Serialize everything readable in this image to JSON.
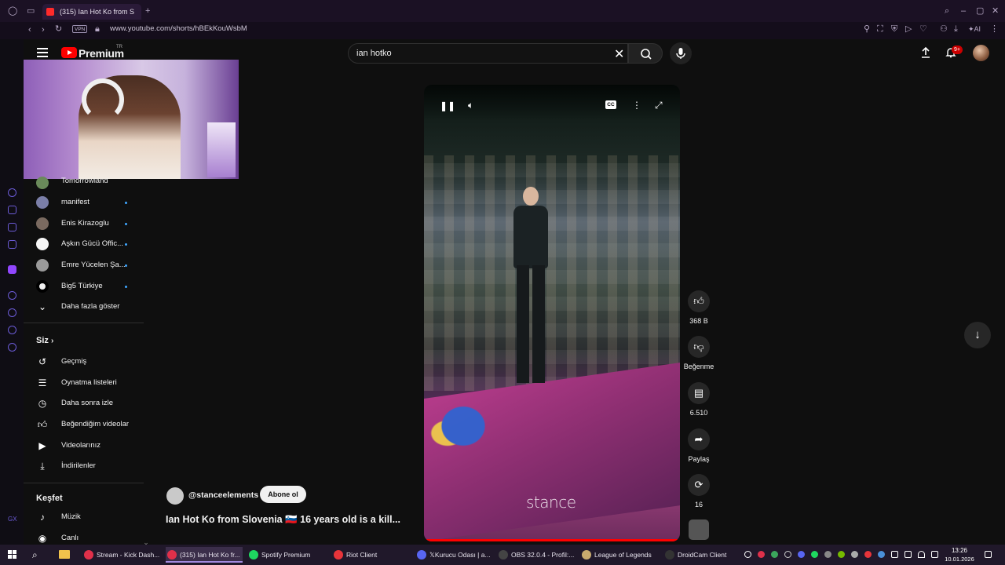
{
  "browser": {
    "tab_title": "(315) Ian Hot Ko from S",
    "url": "www.youtube.com/shorts/hBEkKouWsbM",
    "vpn_label": "VPN",
    "ai_label": "AI"
  },
  "header": {
    "logo_text": "Premium",
    "logo_region": "TR",
    "search_value": "ian hotko",
    "notification_count": "9+"
  },
  "sidebar": {
    "subscriptions": [
      {
        "label": "Tomorrowland"
      },
      {
        "label": "manifest"
      },
      {
        "label": "Enis Kirazoglu"
      },
      {
        "label": "Aşkın Gücü Offic..."
      },
      {
        "label": "Emre Yücelen Şa..."
      },
      {
        "label": "Big5 Türkiye"
      }
    ],
    "show_more": "Daha fazla göster",
    "you_heading": "Siz",
    "you_items": [
      {
        "label": "Geçmiş"
      },
      {
        "label": "Oynatma listeleri"
      },
      {
        "label": "Daha sonra izle"
      },
      {
        "label": "Beğendiğim videolar"
      },
      {
        "label": "Videolarınız"
      },
      {
        "label": "İndirilenler"
      }
    ],
    "explore_heading": "Keşfet",
    "explore_items": [
      {
        "label": "Müzik"
      },
      {
        "label": "Canlı"
      }
    ]
  },
  "video": {
    "cc_label": "CC",
    "watermark": "stance",
    "progress": 1.0,
    "channel_handle": "@stanceelements",
    "subscribe_label": "Abone ol",
    "title": "Ian Hot Ko from Slovenia 🇸🇮 16 years old is a kill..."
  },
  "actions": {
    "likes": "368 B",
    "dislike_label": "Beğenme",
    "comments": "6.510",
    "share_label": "Paylaş",
    "remix_count": "16"
  },
  "taskbar": {
    "apps": [
      {
        "label": "Stream - Kick Dash...",
        "color": "#e0304a"
      },
      {
        "label": "(315) Ian Hot Ko fr...",
        "color": "#e0304a"
      },
      {
        "label": "Spotify Premium",
        "color": "#1ed760"
      },
      {
        "label": "Riot Client",
        "color": "#e8343a"
      },
      {
        "label": "𝕏Kurucu Odası | a...",
        "color": "#5865f2"
      },
      {
        "label": "OBS 32.0.4 - Profil:...",
        "color": "#444444"
      },
      {
        "label": "League of Legends",
        "color": "#c8aa6e"
      },
      {
        "label": "DroidCam Client",
        "color": "#333333"
      }
    ],
    "time": "13:26",
    "date": "10.01.2026"
  }
}
